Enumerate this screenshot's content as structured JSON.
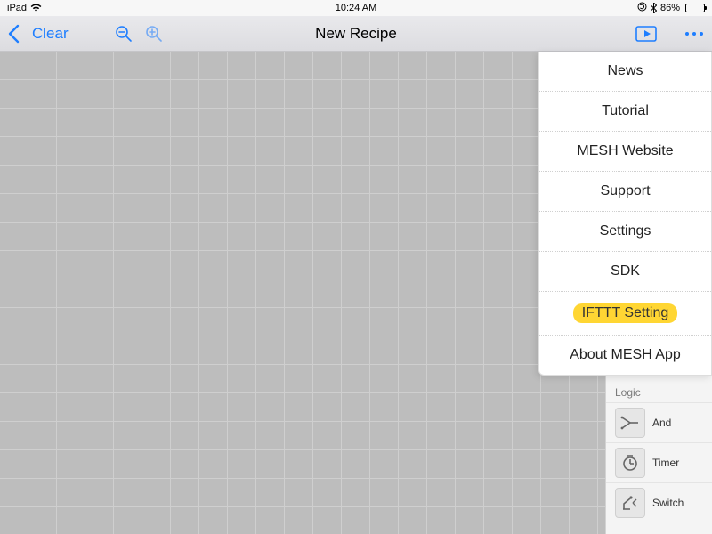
{
  "status": {
    "device": "iPad",
    "time": "10:24 AM",
    "battery_pct": "86%",
    "battery_fill_width": "86%"
  },
  "toolbar": {
    "clear_label": "Clear",
    "title": "New Recipe"
  },
  "menu": {
    "items": [
      "News",
      "Tutorial",
      "MESH Website",
      "Support",
      "Settings",
      "SDK",
      "IFTTT Setting",
      "About MESH App"
    ],
    "highlight_index": 6
  },
  "sidebar": {
    "section_label": "Logic",
    "items": [
      {
        "label": "And",
        "icon": "and-icon"
      },
      {
        "label": "Timer",
        "icon": "timer-icon"
      },
      {
        "label": "Switch",
        "icon": "switch-icon"
      }
    ]
  }
}
